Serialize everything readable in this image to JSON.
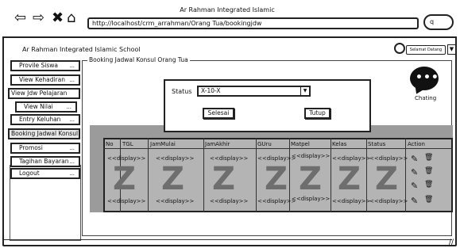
{
  "window": {
    "title": "Ar Rahman Integrated Islamic",
    "url": "http://localhost/crm_arrahman/Orang Tua/bookingjdw",
    "search_glyph": "q"
  },
  "header": {
    "school_name": "Ar Rahman Integrated Islamic School",
    "greeting": "Selamat Datang"
  },
  "sidebar": {
    "items": [
      {
        "label": "Provile Siswa",
        "dots": "...",
        "shaded": false
      },
      {
        "label": "View Kehadiran",
        "dots": "...",
        "shaded": false
      },
      {
        "label": "View Jdw Pelajaran",
        "dots": "",
        "shaded": false
      },
      {
        "label": "View Nilai",
        "dots": "...",
        "shaded": false
      },
      {
        "label": "Entry Keluhan",
        "dots": "...",
        "shaded": false
      },
      {
        "label": "Booking Jadwal Konsul",
        "dots": "",
        "shaded": true
      },
      {
        "label": "Promosi",
        "dots": "...",
        "shaded": false
      },
      {
        "label": "Tagihan Bayaran",
        "dots": "...",
        "shaded": false
      },
      {
        "label": "Logout",
        "dots": "...",
        "shaded": false
      }
    ]
  },
  "main": {
    "legend": "Booking Jadwal Konsul Orang Tua",
    "chat_label": "Chating"
  },
  "modal": {
    "status_label": "Status",
    "status_value": "X-10-X",
    "finish_button": "Selesai",
    "close_button": "Tutup"
  },
  "table": {
    "columns": [
      "No",
      "TGL",
      "JamMulai",
      "JamAkhir",
      "GUru",
      "Matpel",
      "Kelas",
      "Status",
      "Action"
    ],
    "row1": [
      "<<display>>",
      "<<display>>",
      "<<display>>",
      "<<display>>",
      "<<display>>",
      "<<display>>",
      "<<display>>"
    ],
    "row2": [
      "<<display>>",
      "<<display>>",
      "<<display>>",
      "<<display>>",
      "<<display>>",
      "<<display>>",
      "<<display>>"
    ],
    "watermark": "Z",
    "action_icons": [
      "edit-icon",
      "trash-icon"
    ]
  }
}
